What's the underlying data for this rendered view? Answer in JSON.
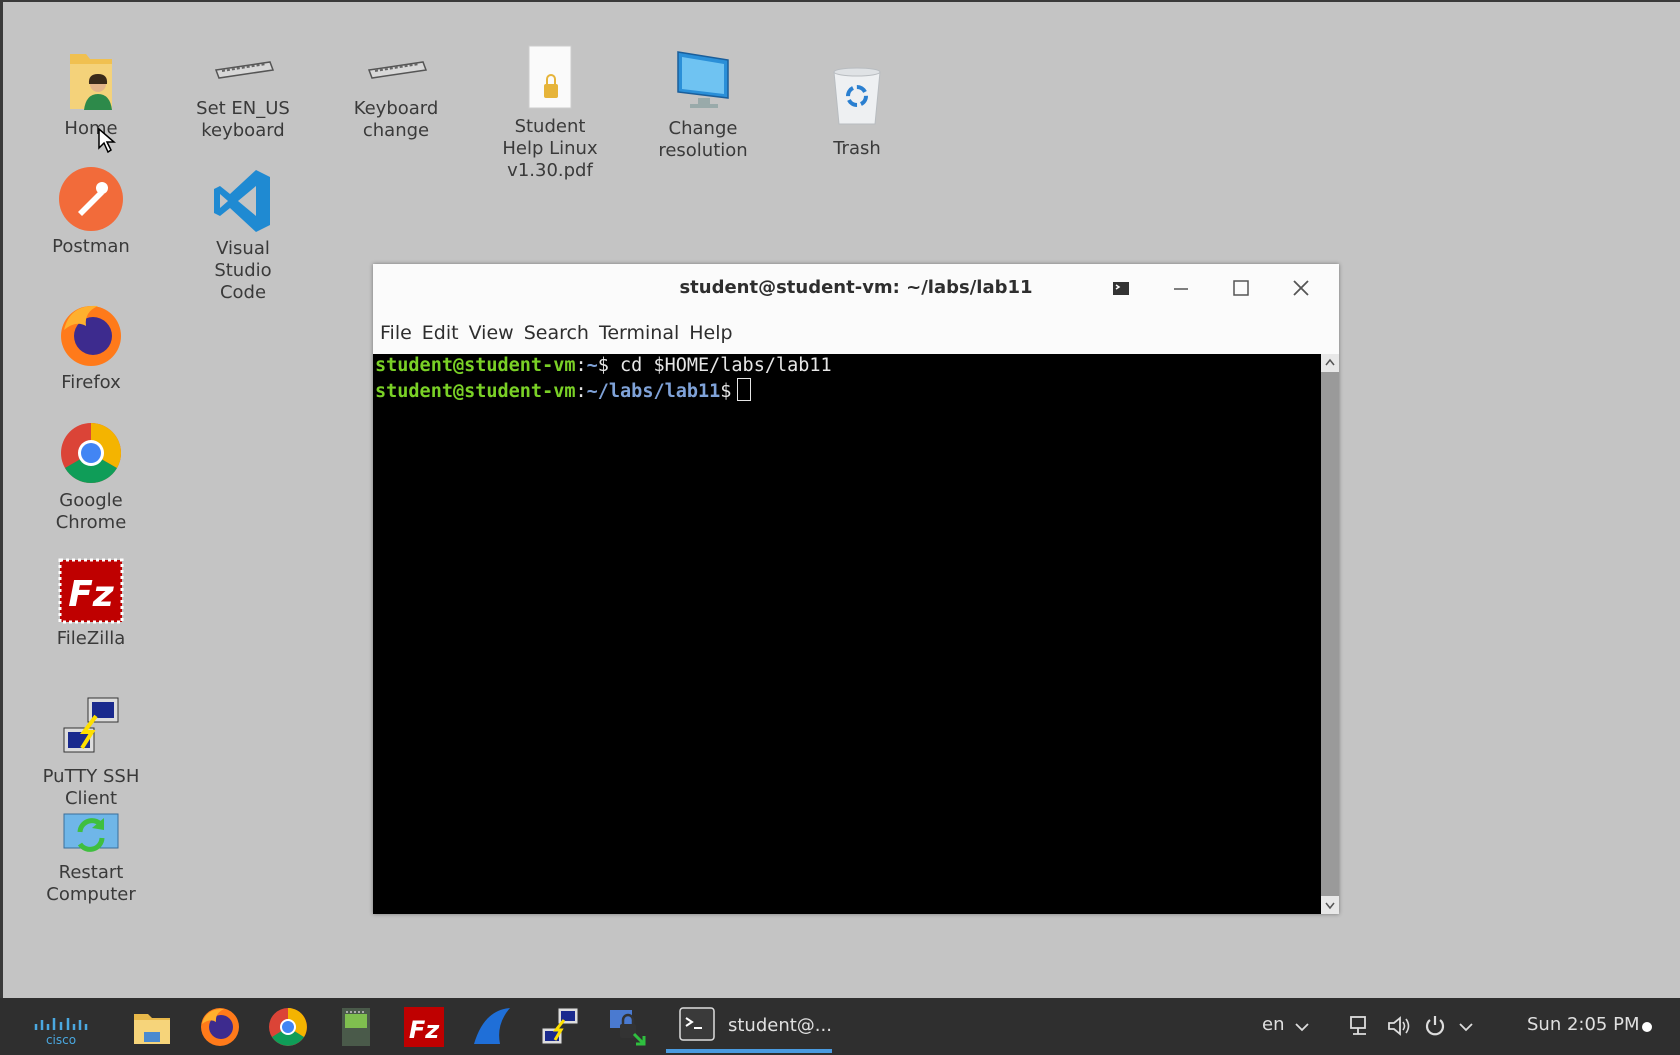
{
  "desktop": {
    "icons": {
      "home": "Home",
      "set_en_us": "Set EN_US\nkeyboard",
      "keyboard_change": "Keyboard\nchange",
      "student_help": "Student\nHelp Linux\nv1.30.pdf",
      "change_resolution": "Change\nresolution",
      "trash": "Trash",
      "postman": "Postman",
      "vscode": "Visual\nStudio\nCode",
      "firefox": "Firefox",
      "chrome": "Google\nChrome",
      "filezilla": "FileZilla",
      "putty": "PuTTY SSH\nClient",
      "restart": "Restart\nComputer"
    }
  },
  "terminal": {
    "title": "student@student-vm: ~/labs/lab11",
    "menu": [
      "File",
      "Edit",
      "View",
      "Search",
      "Terminal",
      "Help"
    ],
    "lines": [
      {
        "user": "student@student-vm",
        "sep": ":",
        "path": "~",
        "prompt": "$",
        "cmd": " cd $HOME/labs/lab11"
      },
      {
        "user": "student@student-vm",
        "sep": ":",
        "path": "~/labs/lab11",
        "prompt": "$",
        "cmd": ""
      }
    ]
  },
  "taskbar": {
    "cisco_logo": "cisco",
    "task_label": "student@...",
    "lang": "en",
    "clock": "Sun 2:05 PM",
    "colors": {
      "accent": "#4a9be0",
      "bg": "#2f2f2f"
    }
  }
}
